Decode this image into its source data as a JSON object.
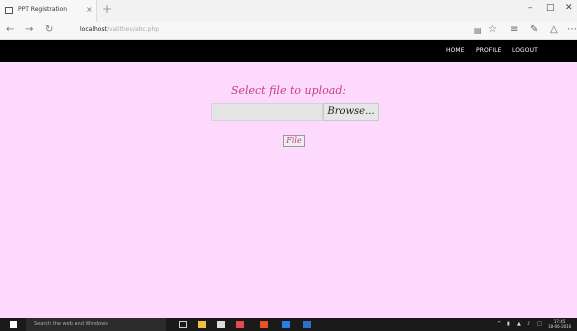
{
  "browser": {
    "tab_title": "PPT Registration",
    "tab_close": "×",
    "new_tab": "+",
    "url_host": "localhost",
    "url_path": "/valithev/abc.php",
    "icons": [
      "tab-page-icon",
      "back-icon",
      "forward-icon",
      "refresh-icon",
      "reading-view-icon",
      "favorites-star-icon",
      "hub-icon",
      "notes-icon",
      "share-icon",
      "more-icon",
      "minimize-icon",
      "maximize-icon",
      "close-icon"
    ]
  },
  "site_nav": {
    "home": "HOME",
    "profile": "PROFILE",
    "logout": "LOGOUT"
  },
  "main": {
    "title": "Select file to upload:",
    "browse_label": "Browse...",
    "file_button_label": "File",
    "colors": {
      "accent": "#c8398a",
      "background": "#fdd9fe"
    }
  },
  "taskbar": {
    "search_placeholder": "Search the web and Windows",
    "time": "17:45",
    "date": "18-06-2016"
  }
}
